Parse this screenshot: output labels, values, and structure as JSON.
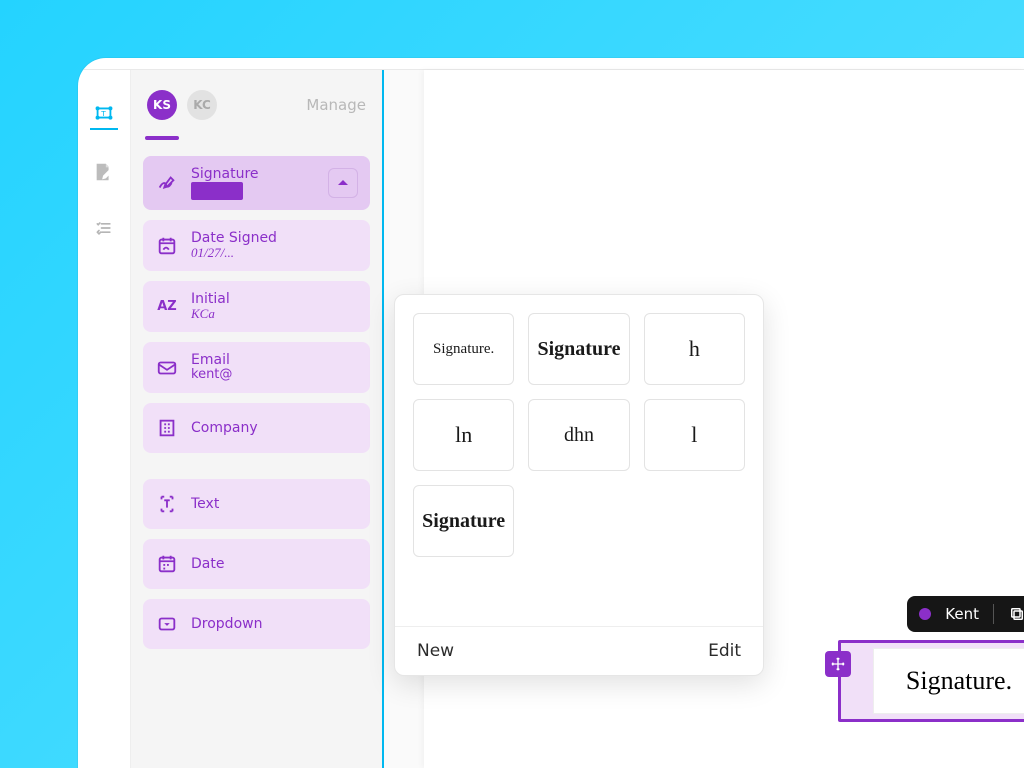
{
  "colors": {
    "accent": "#8b2fc9",
    "cyan": "#24d3ff"
  },
  "signer_row": {
    "avatars": [
      "KS",
      "KC"
    ],
    "manage": "Manage"
  },
  "fields": {
    "signature": {
      "label": "Signature"
    },
    "date_signed": {
      "label": "Date Signed",
      "value": "01/27/..."
    },
    "initial": {
      "label": "Initial",
      "value": "KCa"
    },
    "email": {
      "label": "Email",
      "value": "kent@"
    },
    "company": {
      "label": "Company"
    },
    "text": {
      "label": "Text"
    },
    "date": {
      "label": "Date"
    },
    "dropdown": {
      "label": "Dropdown"
    }
  },
  "popover": {
    "new": "New",
    "edit": "Edit",
    "thumbs": [
      {
        "text": "Signature.",
        "style": "hand1",
        "size": "15px"
      },
      {
        "text": "Signature",
        "style": "script",
        "size": "20px"
      },
      {
        "text": "h",
        "style": "hand1",
        "size": "22px"
      },
      {
        "text": "ln",
        "style": "hand1",
        "size": "22px"
      },
      {
        "text": "dhn",
        "style": "hand1",
        "size": "20px"
      },
      {
        "text": "l",
        "style": "hand1",
        "size": "22px"
      },
      {
        "text": "Signature",
        "style": "script",
        "size": "20px"
      }
    ]
  },
  "placed": {
    "owner": "Kent",
    "content": "Signature."
  }
}
